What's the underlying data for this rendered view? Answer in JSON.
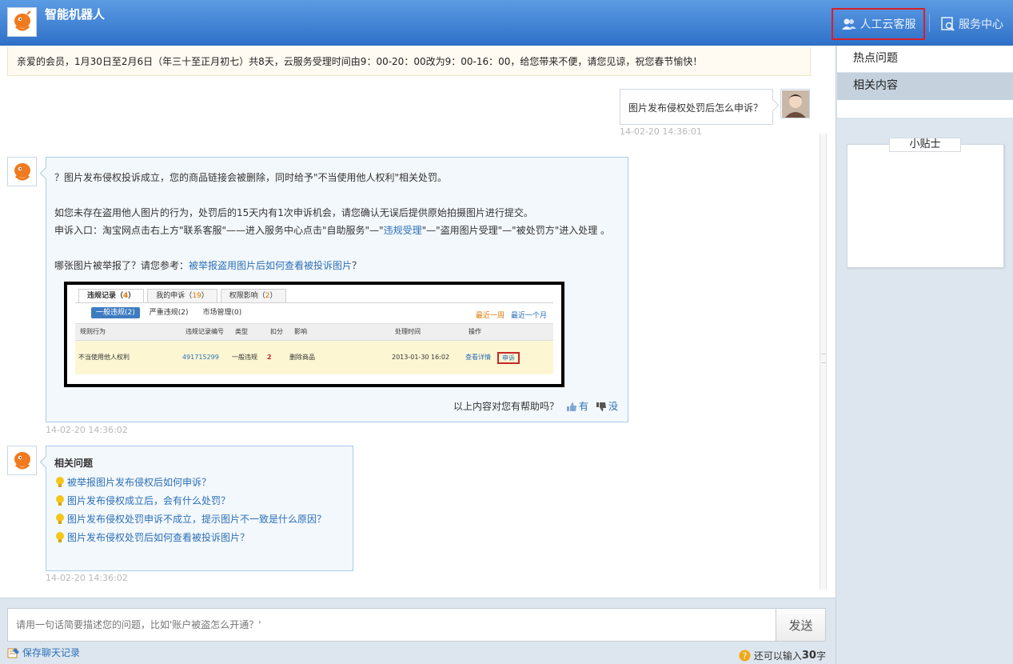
{
  "header": {
    "title": "智能机器人",
    "human_service_label": "人工云客服",
    "service_center_label": "服务中心"
  },
  "notice": "亲爱的会员，1月30日至2月6日（年三十至正月初七）共8天，云服务受理时间由9：00-20：00改为9：00-16：00，给您带来不便，请您见谅，祝您春节愉快！",
  "user_message": {
    "text": "图片发布侵权处罚后怎么申诉？",
    "time": "14-02-20 14:36:01"
  },
  "answer": {
    "line1": "？图片发布侵权投诉成立，您的商品链接会被删除，同时给予\"不当使用他人权利\"相关处罚。",
    "line2": "如您未存在盗用他人图片的行为，处罚后的15天内有1次申诉机会，请您确认无误后提供原始拍摄图片进行提交。",
    "line3_a": "申诉入口：淘宝网点击右上方\"联系客服\"——进入服务中心点击\"自助服务\"—\"",
    "line3_link": "违规受理",
    "line3_b": "\"—\"盗用图片受理\"—\"被处罚方\"进入处理 。",
    "line4_a": "哪张图片被举报了？请您参考：",
    "line4_link": "被举报盗用图片后如何查看被投诉图片",
    "line4_b": "？",
    "time": "14-02-20 14:36:02",
    "feedback_prompt": "以上内容对您有帮助吗？",
    "feedback_yes": "有",
    "feedback_no": "没"
  },
  "screenshot": {
    "tab1": "违规记录（",
    "tab1_count": "4",
    "tab1_end": "）",
    "tab2": "我的申诉（",
    "tab2_count": "19",
    "tab2_end": "）",
    "tab3": "权限影响（",
    "tab3_count": "2",
    "tab3_end": "）",
    "sub1": "一般违规(2)",
    "sub2": "严重违规(2)",
    "sub3": "市场管理(0)",
    "range_week": "最近一周",
    "range_month": "最近一个月",
    "col_rule": "规则行为",
    "col_no": "违规记录编号",
    "col_type": "类型",
    "col_points": "扣分",
    "col_effect": "影响",
    "col_time": "处理时间",
    "col_action": "操作",
    "row_rule": "不当使用他人权利",
    "row_no": "491715299",
    "row_type": "一般违规",
    "row_points": "2",
    "row_effect": "删除商品",
    "row_time": "2013-01-30 16:02",
    "row_detail": "查看详情",
    "row_appeal": "申诉"
  },
  "related": {
    "title": "相关问题",
    "items": [
      "被举报图片发布侵权后如何申诉？",
      "图片发布侵权成立后，会有什么处罚？",
      "图片发布侵权处罚申诉不成立，提示图片不一致是什么原因？",
      "图片发布侵权处罚后如何查看被投诉图片？"
    ],
    "time": "14-02-20 14:36:02"
  },
  "input": {
    "placeholder": "请用一句话简要描述您的问题，比如'账户被盗怎么开通？'",
    "send_label": "发送",
    "save_label": "保存聊天记录",
    "remain_prefix": "还可以输入",
    "remain_count": "30",
    "remain_suffix": "字"
  },
  "sidebar": {
    "tab_hot": "热点问题",
    "tab_related": "相关内容",
    "tips_title": "小贴士"
  },
  "colors": {
    "header": "#2f71c9",
    "link": "#2c6fb7",
    "highlight_border": "#d6202a",
    "bubble_border": "#a9cbe6",
    "sidebar_bg": "#dde6ef"
  }
}
